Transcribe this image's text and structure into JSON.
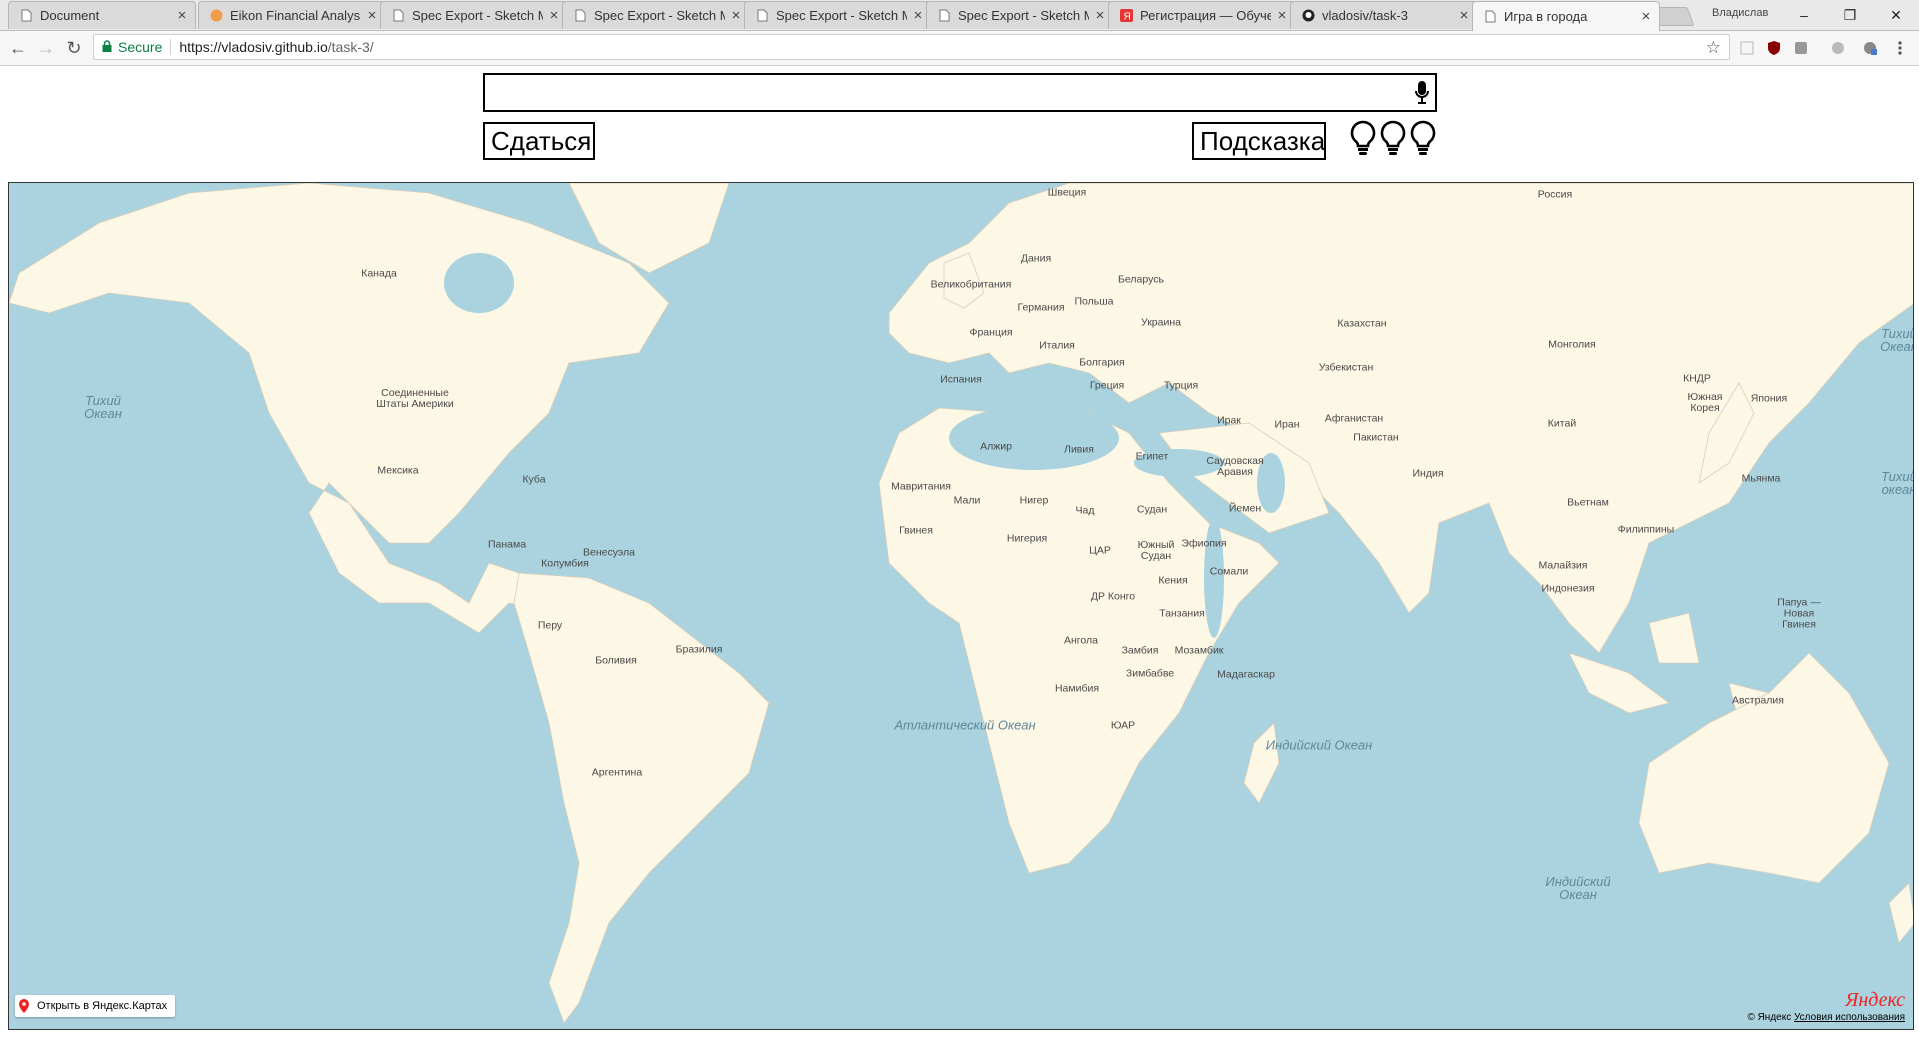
{
  "browser": {
    "tabs": [
      {
        "title": "Document",
        "favicon": "doc-icon"
      },
      {
        "title": "Eikon Financial Analysis",
        "favicon": "eikon-icon"
      },
      {
        "title": "Spec Export - Sketch M",
        "favicon": "doc-icon"
      },
      {
        "title": "Spec Export - Sketch M",
        "favicon": "doc-icon"
      },
      {
        "title": "Spec Export - Sketch M",
        "favicon": "doc-icon"
      },
      {
        "title": "Spec Export - Sketch M",
        "favicon": "doc-icon"
      },
      {
        "title": "Регистрация — Обуче",
        "favicon": "yandex-icon"
      },
      {
        "title": "vladosiv/task-3",
        "favicon": "github-icon"
      },
      {
        "title": "Игра в города",
        "favicon": "doc-icon",
        "active": true
      }
    ],
    "profile_name": "Владислав",
    "secure_label": "Secure",
    "url_host": "https://vladosiv.github.io",
    "url_path": "/task-3/"
  },
  "game": {
    "input_value": "",
    "surrender_label": "Сдаться",
    "hint_label": "Подсказка",
    "hints_remaining": 3
  },
  "map": {
    "country_labels": [
      "Швеция",
      "Россия",
      "Канада",
      "Дания",
      "Великобритания",
      "Беларусь",
      "Германия",
      "Польша",
      "Украина",
      "Франция",
      "Италия",
      "Казахстан",
      "Монголия",
      "Болгария",
      "Узбекистан",
      "КНДР",
      "Испания",
      "Греция",
      "Турция",
      "Южная Корея",
      "Япония",
      "Соединенные Штаты Америки",
      "Ирак",
      "Иран",
      "Афганистан",
      "Китай",
      "Пакистан",
      "Алжир",
      "Ливия",
      "Египет",
      "Саудовская Аравия",
      "Мексика",
      "Индия",
      "Мьянма",
      "Куба",
      "Мавритания",
      "Мали",
      "Нигер",
      "Чад",
      "Судан",
      "Йемен",
      "Вьетнам",
      "Гвинея",
      "Нигерия",
      "Филиппины",
      "Эфиопия",
      "Панама",
      "Венесуэла",
      "Южный Судан",
      "ЦАР",
      "Колумбия",
      "Малайзия",
      "Сомали",
      "Кения",
      "ДР Конго",
      "Индонезия",
      "Танзания",
      "Папуа — Новая Гвинея",
      "Перу",
      "Бразилия",
      "Ангола",
      "Замбия",
      "Мозамбик",
      "Боливия",
      "Мадагаскар",
      "Зимбабве",
      "Намибия",
      "Австралия",
      "ЮАР",
      "Аргентина"
    ],
    "ocean_labels": [
      "Тихий Океан",
      "Атлантический Океан",
      "Индийский Океан",
      "Индийский Океан",
      "Тихий Океан",
      "Тихий океан"
    ],
    "open_in_maps_label": "Открыть в Яндекс.Картах",
    "logo_text": "Яндекс",
    "copyright": "© Яндекс",
    "terms_link": "Условия использования",
    "colors": {
      "water": "#aad3df",
      "land": "#fdf7e6",
      "borders": "#c9bfae"
    }
  }
}
